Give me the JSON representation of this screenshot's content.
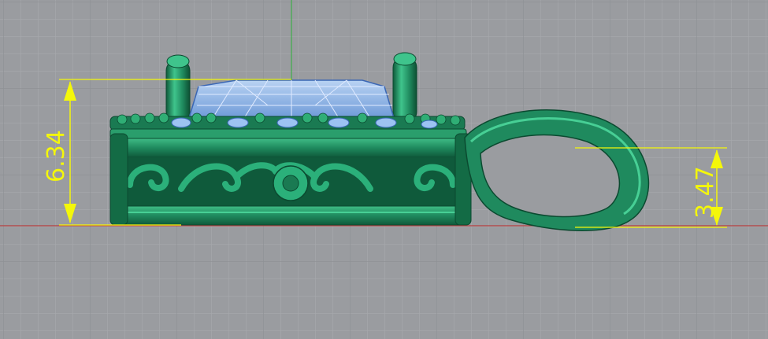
{
  "viewport": {
    "background": "#9a9ca0",
    "grid_minor_color": "#a7a9ad",
    "grid_major_color": "#8e9095",
    "axis_y_color": "#3fae4a",
    "axis_x_color": "#b84040"
  },
  "model": {
    "metal_color": "#1f8a5e",
    "stone_color": "#8fb6e8"
  },
  "dimensions": {
    "color": "#f4f70a",
    "height_label": "6.34",
    "bail_label": "3.47"
  }
}
